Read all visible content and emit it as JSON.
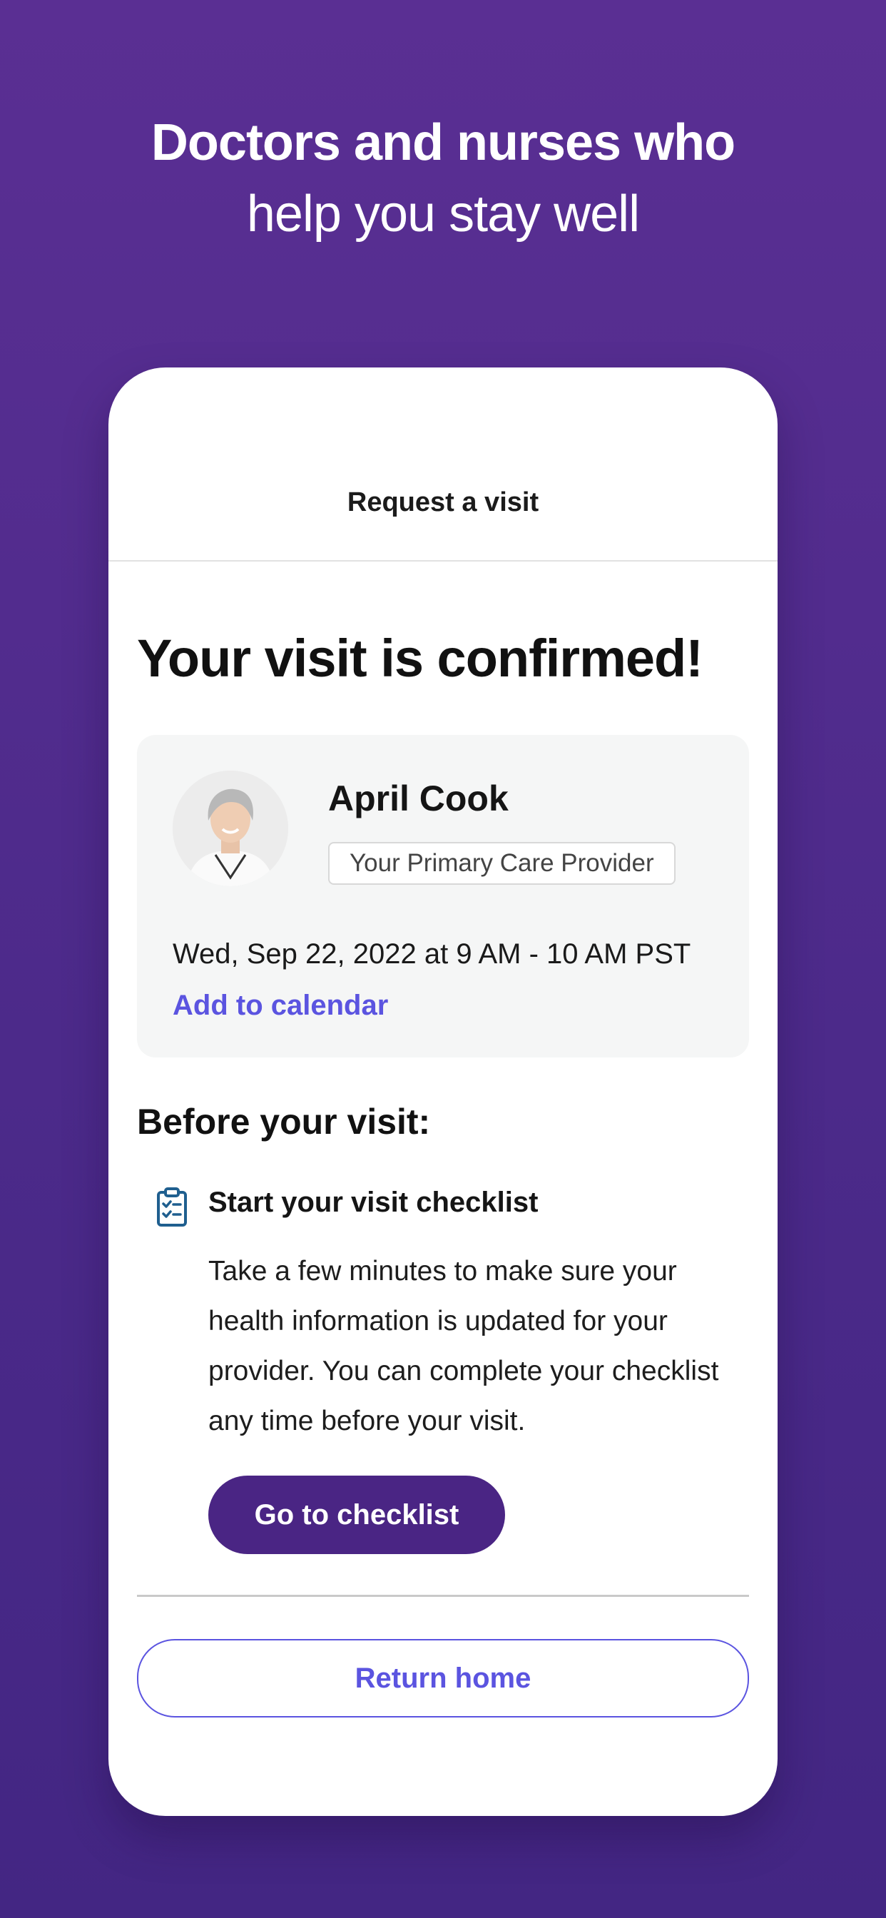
{
  "headline": {
    "line1": "Doctors and nurses who",
    "line2": "help you stay well"
  },
  "nav": {
    "title": "Request a visit"
  },
  "confirmation": {
    "title": "Your visit is confirmed!"
  },
  "provider": {
    "name": "April Cook",
    "role": "Your Primary Care Provider",
    "visit_time": "Wed, Sep 22, 2022 at 9 AM - 10 AM PST",
    "add_to_calendar": "Add to calendar"
  },
  "before_visit": {
    "title": "Before your visit:",
    "checklist_title": "Start your visit checklist",
    "checklist_body": "Take a few minutes to make sure your health information is updated for your provider. You can complete your checklist any time before your visit.",
    "checklist_button": "Go to checklist"
  },
  "footer": {
    "return_home": "Return home"
  },
  "colors": {
    "background": "#52298c",
    "accent_link": "#5b54e0",
    "primary_button": "#4a2584",
    "icon": "#1f5f8f"
  },
  "icons": {
    "checklist": "clipboard-checklist-icon",
    "avatar": "provider-photo"
  }
}
